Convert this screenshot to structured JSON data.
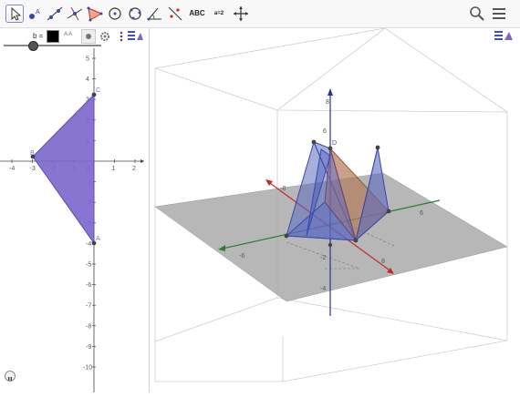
{
  "toolbar": {
    "tools": [
      {
        "name": "move-tool",
        "label": ""
      },
      {
        "name": "point-tool",
        "label": ""
      },
      {
        "name": "line-tool",
        "label": ""
      },
      {
        "name": "perpendicular-tool",
        "label": ""
      },
      {
        "name": "polygon-tool",
        "label": ""
      },
      {
        "name": "circle-tool",
        "label": ""
      },
      {
        "name": "circle-three-points-tool",
        "label": ""
      },
      {
        "name": "angle-tool",
        "label": ""
      },
      {
        "name": "reflect-tool",
        "label": ""
      },
      {
        "name": "text-tool",
        "label": "ABC"
      },
      {
        "name": "slider-tool",
        "label": "a=2"
      },
      {
        "name": "move-view-tool",
        "label": ""
      }
    ]
  },
  "algebra": {
    "slider_label": "b =",
    "text_size_label": "A A",
    "slider_value_fraction": 0.3
  },
  "graphics2d": {
    "x_ticks": [
      "-4",
      "-3",
      "-2",
      "-1",
      "0",
      "1",
      "2"
    ],
    "y_ticks": [
      "5",
      "4",
      "3",
      "2",
      "1",
      "-1",
      "-2",
      "-3",
      "-4",
      "-5",
      "-6",
      "-7",
      "-8",
      "-9",
      "-10"
    ],
    "points": {
      "A": "A",
      "B": "B",
      "C": "C"
    }
  },
  "graphics3d": {
    "axis_labels": {
      "z_top": "8",
      "z_6": "6",
      "y_neg": "-6",
      "y_pos": "6",
      "x_neg": "-8",
      "x_pos": "8",
      "z_neg": "-2",
      "z_neg4": "-4",
      "pt_d": "D"
    }
  },
  "colors": {
    "polygon_fill": "#7a66cc",
    "polygon_stroke": "#5c4ab0",
    "plane": "#aaaaaa",
    "accent": "#3f51b5"
  }
}
